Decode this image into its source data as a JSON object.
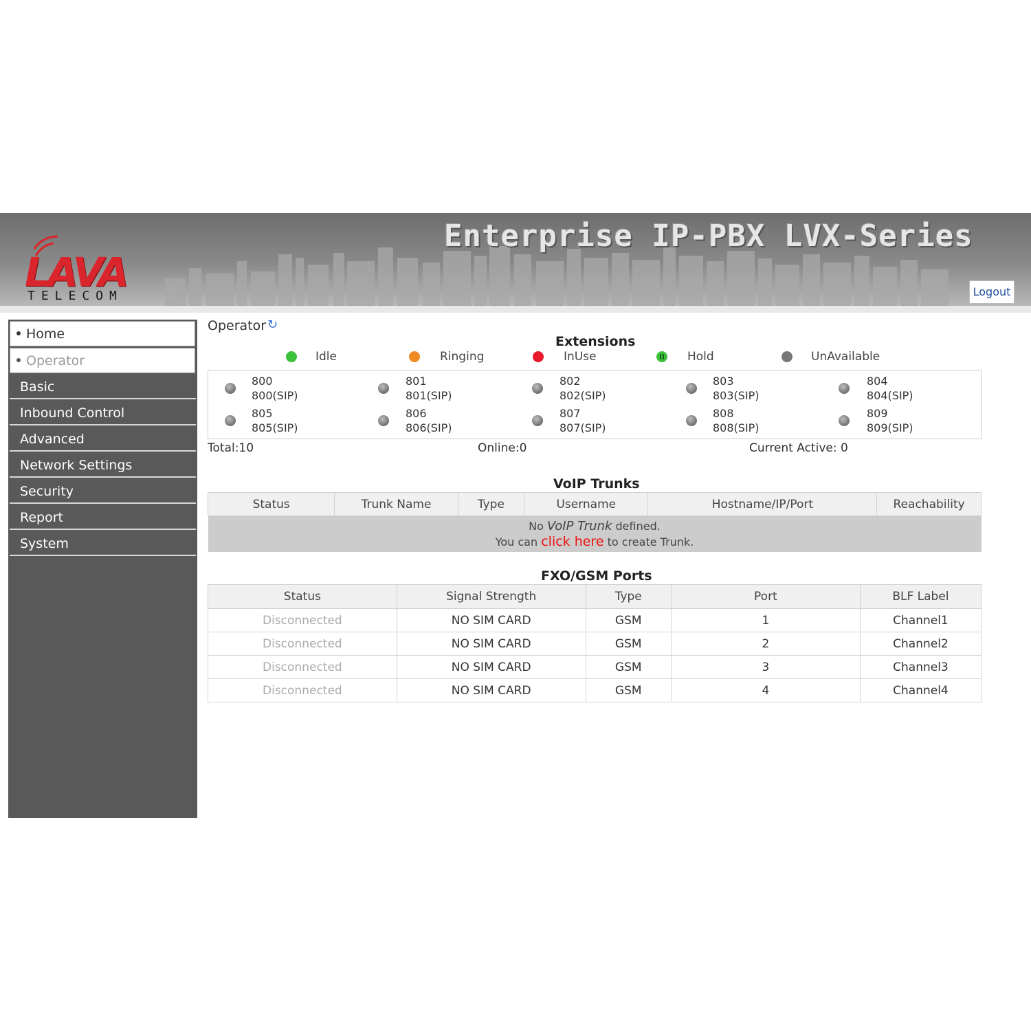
{
  "header": {
    "title": "Enterprise IP-PBX LVX-Series",
    "logo_text": "LAVA",
    "logo_subtext": "TELECOM",
    "logout_label": "Logout"
  },
  "sidebar": {
    "top_items": [
      {
        "label": "Home"
      },
      {
        "label": "Operator",
        "active": true
      }
    ],
    "menu": [
      {
        "label": "Basic"
      },
      {
        "label": "Inbound Control"
      },
      {
        "label": "Advanced"
      },
      {
        "label": "Network Settings"
      },
      {
        "label": "Security"
      },
      {
        "label": "Report"
      },
      {
        "label": "System"
      }
    ]
  },
  "operator": {
    "title": "Operator",
    "refresh_icon": "refresh-icon"
  },
  "extensions": {
    "title": "Extensions",
    "legend": [
      {
        "label": "Idle",
        "color": "#3cc13c"
      },
      {
        "label": "Ringing",
        "color": "#f08a24"
      },
      {
        "label": "InUse",
        "color": "#e8192c"
      },
      {
        "label": "Hold",
        "color": "#3cc13c"
      },
      {
        "label": "UnAvailable",
        "color": "#777777"
      }
    ],
    "items": [
      {
        "number": "800",
        "name": "800(SIP)"
      },
      {
        "number": "801",
        "name": "801(SIP)"
      },
      {
        "number": "802",
        "name": "802(SIP)"
      },
      {
        "number": "803",
        "name": "803(SIP)"
      },
      {
        "number": "804",
        "name": "804(SIP)"
      },
      {
        "number": "805",
        "name": "805(SIP)"
      },
      {
        "number": "806",
        "name": "806(SIP)"
      },
      {
        "number": "807",
        "name": "807(SIP)"
      },
      {
        "number": "808",
        "name": "808(SIP)"
      },
      {
        "number": "809",
        "name": "809(SIP)"
      }
    ],
    "total": "Total:10",
    "online": "Online:0",
    "current_active": "Current Active: 0"
  },
  "voip_trunks": {
    "title": "VoIP Trunks",
    "columns": [
      "Status",
      "Trunk Name",
      "Type",
      "Username",
      "Hostname/IP/Port",
      "Reachability"
    ],
    "empty_prefix": "No ",
    "empty_italic": "VoIP Trunk",
    "empty_suffix": " defined.",
    "create_prefix": "You can ",
    "create_link": "click here",
    "create_suffix": " to create Trunk."
  },
  "fxo_gsm": {
    "title": "FXO/GSM Ports",
    "columns": [
      "Status",
      "Signal Strength",
      "Type",
      "Port",
      "BLF Label"
    ],
    "rows": [
      [
        "Disconnected",
        "NO SIM CARD",
        "GSM",
        "1",
        "Channel1"
      ],
      [
        "Disconnected",
        "NO SIM CARD",
        "GSM",
        "2",
        "Channel2"
      ],
      [
        "Disconnected",
        "NO SIM CARD",
        "GSM",
        "3",
        "Channel3"
      ],
      [
        "Disconnected",
        "NO SIM CARD",
        "GSM",
        "4",
        "Channel4"
      ]
    ]
  }
}
